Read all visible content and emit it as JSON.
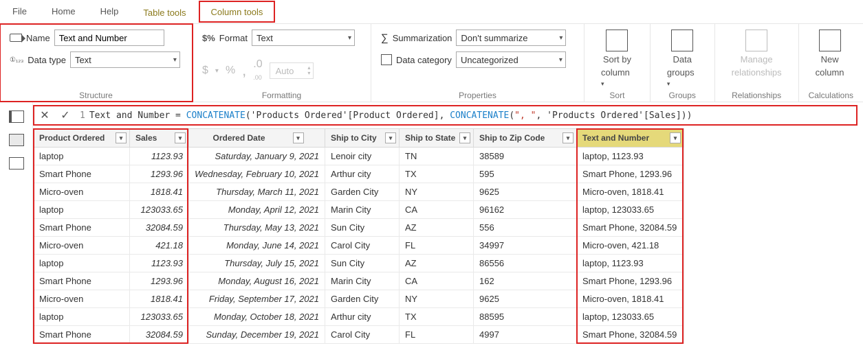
{
  "ribbonTabs": {
    "file": "File",
    "home": "Home",
    "help": "Help",
    "tableTools": "Table tools",
    "columnTools": "Column tools"
  },
  "structure": {
    "nameLabel": "Name",
    "nameValue": "Text and Number",
    "typeLabel": "Data type",
    "typeValue": "Text",
    "groupLabel": "Structure"
  },
  "formatting": {
    "formatLabel": "Format",
    "formatValue": "Text",
    "currency": "$",
    "percent": "%",
    "comma": ",",
    "dec1": ".0",
    "dec2": ".00",
    "autoLabel": "Auto",
    "groupLabel": "Formatting"
  },
  "properties": {
    "sumLabel": "Summarization",
    "sumValue": "Don't summarize",
    "catLabel": "Data category",
    "catValue": "Uncategorized",
    "groupLabel": "Properties"
  },
  "sortGroup": {
    "label": "Sort",
    "btn1a": "Sort by",
    "btn1b": "column"
  },
  "groupsGroup": {
    "label": "Groups",
    "btn1a": "Data",
    "btn1b": "groups"
  },
  "relGroup": {
    "label": "Relationships",
    "btn1a": "Manage",
    "btn1b": "relationships"
  },
  "calcGroup": {
    "label": "Calculations",
    "btn1a": "New",
    "btn1b": "column"
  },
  "formula": {
    "lineNum": "1",
    "pre": "Text and Number = ",
    "fn1": "CONCATENATE",
    "arg1": "'Products Ordered'[Product Ordered]",
    "fn2": "CONCATENATE",
    "str": "\", \"",
    "arg2": "'Products Ordered'[Sales]"
  },
  "columns": {
    "product": "Product Ordered",
    "sales": "Sales",
    "date": "Ordered Date",
    "city": "Ship to City",
    "state": "Ship to State",
    "zip": "Ship to Zip Code",
    "text": "Text and Number"
  },
  "rows": [
    {
      "product": "laptop",
      "sales": "1123.93",
      "date": "Saturday, January 9, 2021",
      "city": "Lenoir city",
      "state": "TN",
      "zip": "38589",
      "text": "laptop, 1123.93"
    },
    {
      "product": "Smart Phone",
      "sales": "1293.96",
      "date": "Wednesday, February 10, 2021",
      "city": "Arthur city",
      "state": "TX",
      "zip": "595",
      "text": "Smart Phone, 1293.96"
    },
    {
      "product": "Micro-oven",
      "sales": "1818.41",
      "date": "Thursday, March 11, 2021",
      "city": "Garden City",
      "state": "NY",
      "zip": "9625",
      "text": "Micro-oven, 1818.41"
    },
    {
      "product": "laptop",
      "sales": "123033.65",
      "date": "Monday, April 12, 2021",
      "city": "Marin City",
      "state": "CA",
      "zip": "96162",
      "text": "laptop, 123033.65"
    },
    {
      "product": "Smart Phone",
      "sales": "32084.59",
      "date": "Thursday, May 13, 2021",
      "city": "Sun City",
      "state": "AZ",
      "zip": "556",
      "text": "Smart Phone, 32084.59"
    },
    {
      "product": "Micro-oven",
      "sales": "421.18",
      "date": "Monday, June 14, 2021",
      "city": "Carol City",
      "state": "FL",
      "zip": "34997",
      "text": "Micro-oven, 421.18"
    },
    {
      "product": "laptop",
      "sales": "1123.93",
      "date": "Thursday, July 15, 2021",
      "city": "Sun City",
      "state": "AZ",
      "zip": "86556",
      "text": "laptop, 1123.93"
    },
    {
      "product": "Smart Phone",
      "sales": "1293.96",
      "date": "Monday, August 16, 2021",
      "city": "Marin City",
      "state": "CA",
      "zip": "162",
      "text": "Smart Phone, 1293.96"
    },
    {
      "product": "Micro-oven",
      "sales": "1818.41",
      "date": "Friday, September 17, 2021",
      "city": "Garden City",
      "state": "NY",
      "zip": "9625",
      "text": "Micro-oven, 1818.41"
    },
    {
      "product": "laptop",
      "sales": "123033.65",
      "date": "Monday, October 18, 2021",
      "city": "Arthur city",
      "state": "TX",
      "zip": "88595",
      "text": "laptop, 123033.65"
    },
    {
      "product": "Smart Phone",
      "sales": "32084.59",
      "date": "Sunday, December 19, 2021",
      "city": "Carol City",
      "state": "FL",
      "zip": "4997",
      "text": "Smart Phone, 32084.59"
    }
  ]
}
